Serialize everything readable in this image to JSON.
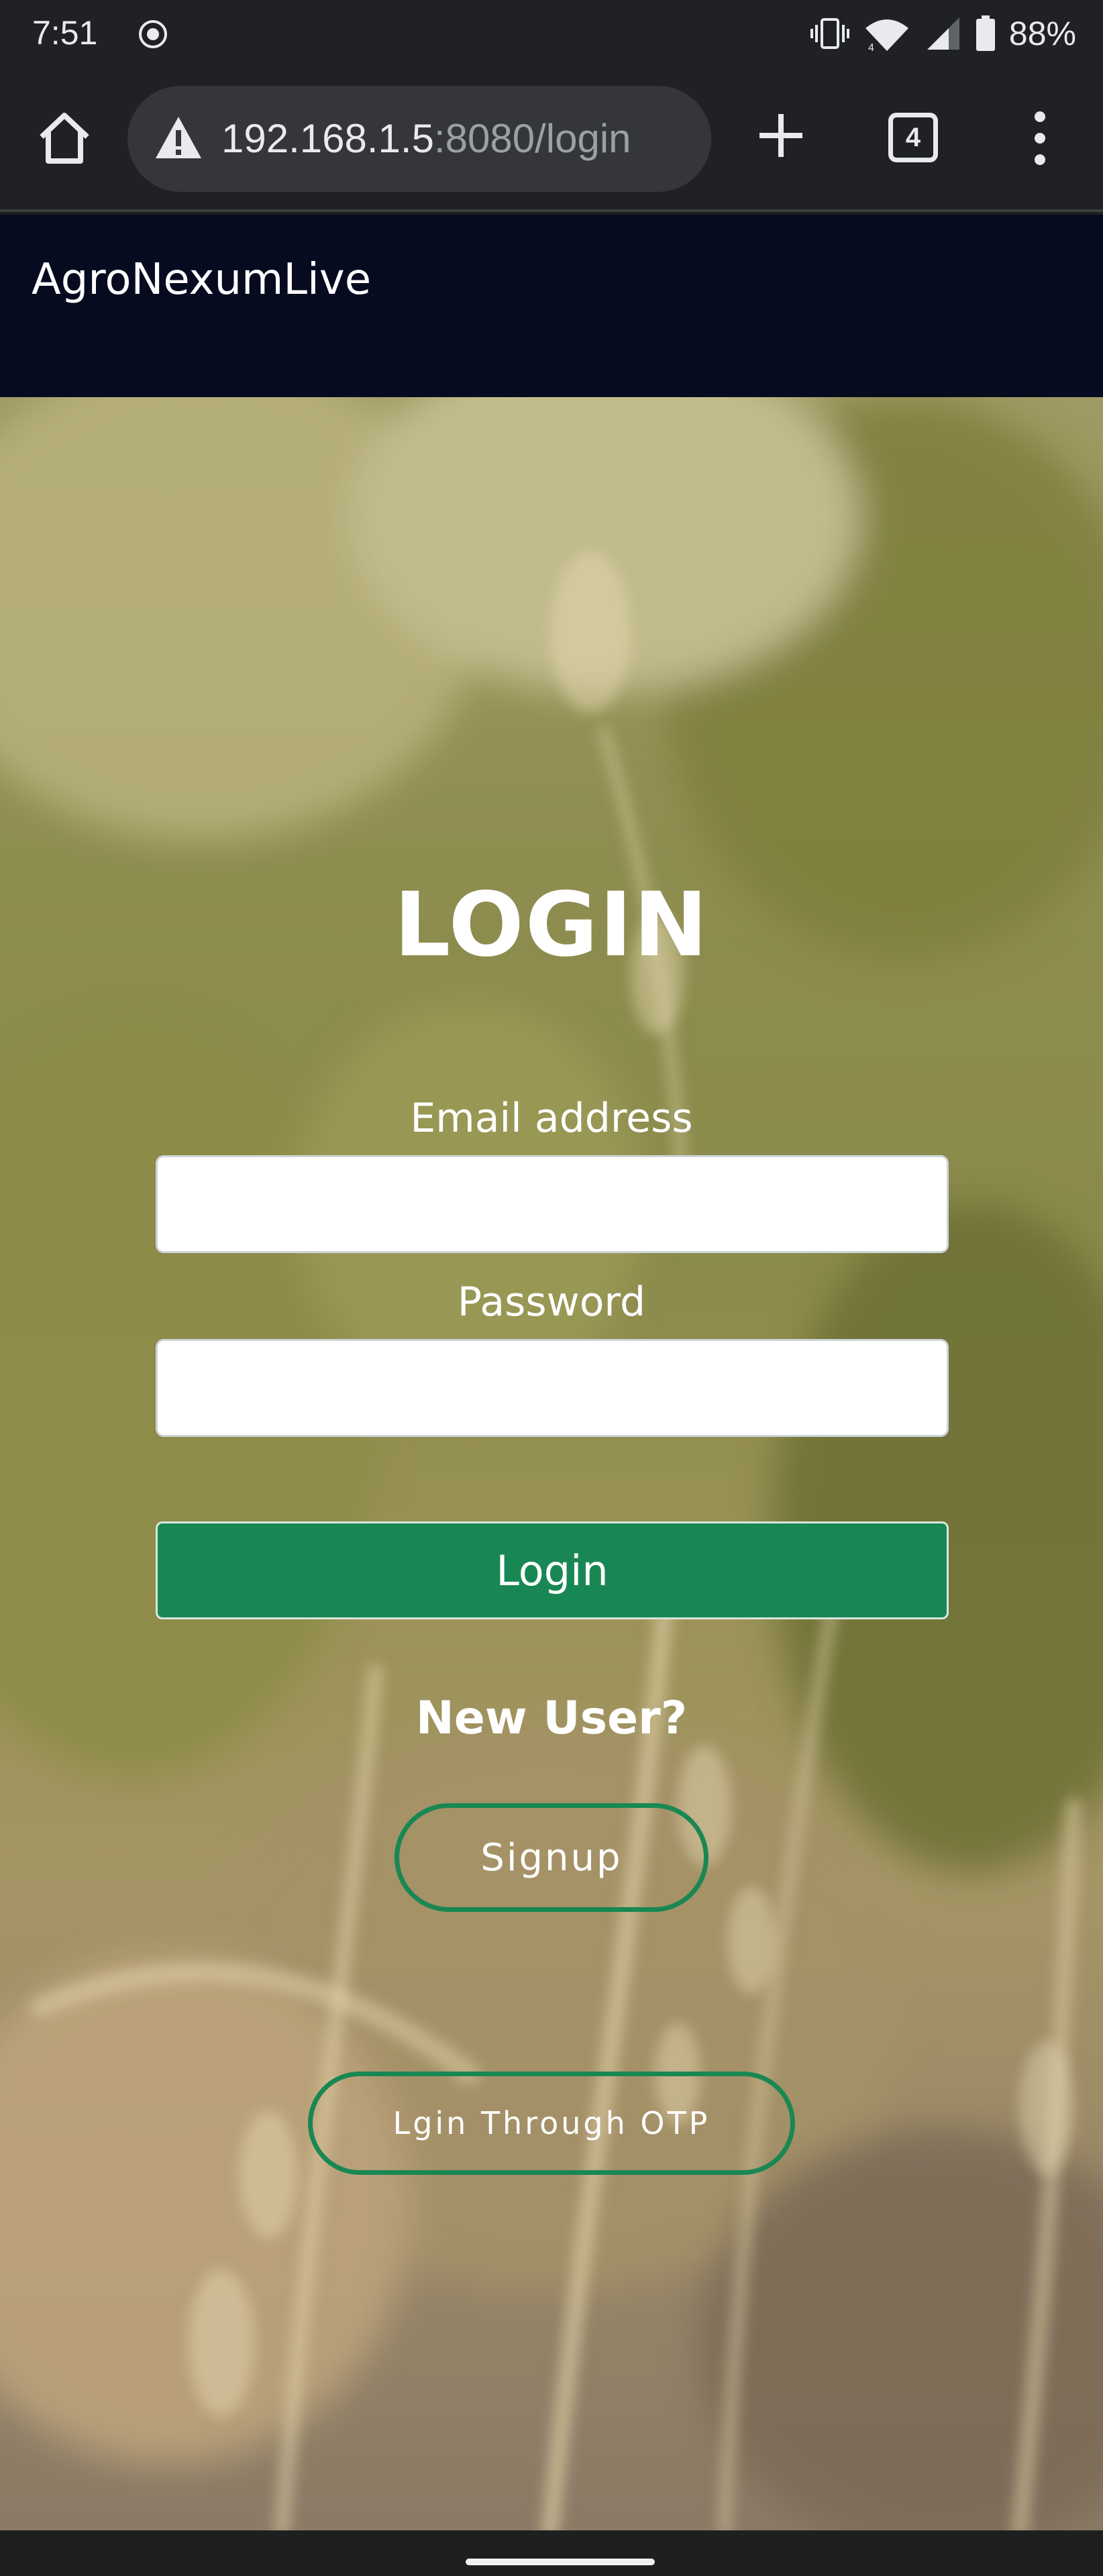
{
  "status_bar": {
    "time": "7:51",
    "battery": "88%",
    "icons": [
      "screen-record-icon",
      "vibrate-icon",
      "wifi-icon",
      "cell-signal-icon",
      "battery-icon"
    ]
  },
  "browser": {
    "url_host": "192.168.1.5",
    "url_rest": ":8080/login",
    "tab_count": "4",
    "icons": [
      "home-icon",
      "not-secure-warning-icon",
      "new-tab-icon",
      "tab-switcher-icon",
      "more-menu-icon"
    ]
  },
  "site": {
    "brand": "AgroNexumLive"
  },
  "login": {
    "title": "LOGIN",
    "email_label": "Email address",
    "email_value": "",
    "password_label": "Password",
    "password_value": "",
    "submit_label": "Login",
    "new_user_text": "New User?",
    "signup_label": "Signup",
    "otp_label": "Lgin Through OTP"
  },
  "colors": {
    "nav_bg": "#060b1f",
    "primary_green": "#198754",
    "chrome_bg": "#202124"
  }
}
